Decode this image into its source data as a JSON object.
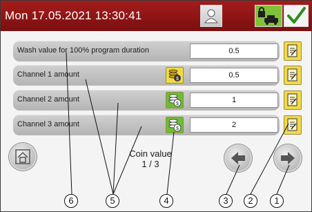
{
  "header": {
    "datetime": "Mon 17.05.2021  13:30:41",
    "colors": {
      "bar": "#8e1616",
      "lock_button": "#7fc23a",
      "check_mark": "#2e8b1e"
    },
    "icons": [
      "user-icon",
      "lock-car-icon",
      "check-icon"
    ]
  },
  "rows": [
    {
      "label": "Wash value for 100% program duration",
      "value": "0.5"
    },
    {
      "label": "Channel 1 amount",
      "value": "0.5",
      "coin_icon": "coin-stack-icon",
      "coin_color": "yellow"
    },
    {
      "label": "Channel 2 amount",
      "value": "1",
      "coin_icon": "coin-stack-icon",
      "coin_color": "green"
    },
    {
      "label": "Channel 3 amount",
      "value": "2",
      "coin_icon": "coin-stack-icon",
      "coin_color": "green"
    }
  ],
  "footer": {
    "caption": "Coin value",
    "page": "1 / 3",
    "icons": [
      "home-icon",
      "arrow-left-icon",
      "arrow-right-icon"
    ]
  },
  "callouts": [
    "6",
    "5",
    "4",
    "3",
    "2",
    "1"
  ]
}
